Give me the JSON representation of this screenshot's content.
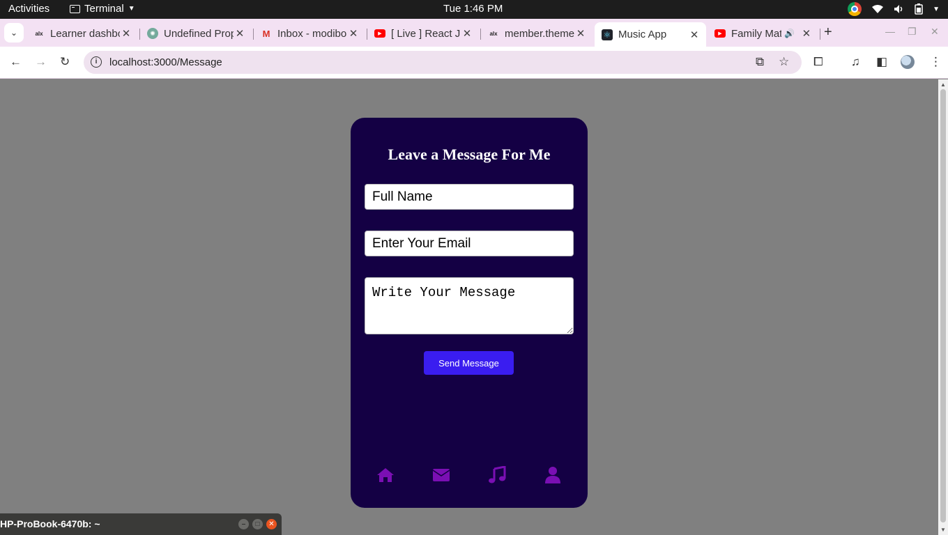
{
  "topbar": {
    "activities": "Activities",
    "app_name": "Terminal",
    "clock": "Tue  1:46 PM"
  },
  "tabs": [
    {
      "title": "Learner dashboard",
      "favicon": "alx"
    },
    {
      "title": "Undefined Property",
      "favicon": "chatgpt"
    },
    {
      "title": "Inbox - modibo",
      "favicon": "gmail"
    },
    {
      "title": "[ Live ] React JS",
      "favicon": "youtube"
    },
    {
      "title": "member.theme",
      "favicon": "alx"
    },
    {
      "title": "Music App",
      "favicon": "react",
      "active": true
    },
    {
      "title": "Family Matters",
      "favicon": "youtube",
      "audio": true
    }
  ],
  "toolbar": {
    "url": "localhost:3000/Message"
  },
  "form": {
    "heading": "Leave a Message For Me",
    "name_placeholder": "Full Name",
    "email_placeholder": "Enter Your Email",
    "message_placeholder": "Write Your Message",
    "send_label": "Send Message"
  },
  "nav_icons": [
    "home-icon",
    "envelope-icon",
    "music-icon",
    "user-icon"
  ],
  "colors": {
    "card_bg": "#140044",
    "button_bg": "#3a1df0",
    "nav_icon": "#7a0fb3",
    "page_bg": "#808080"
  },
  "terminal_window": {
    "title": "HP-ProBook-6470b: ~"
  }
}
